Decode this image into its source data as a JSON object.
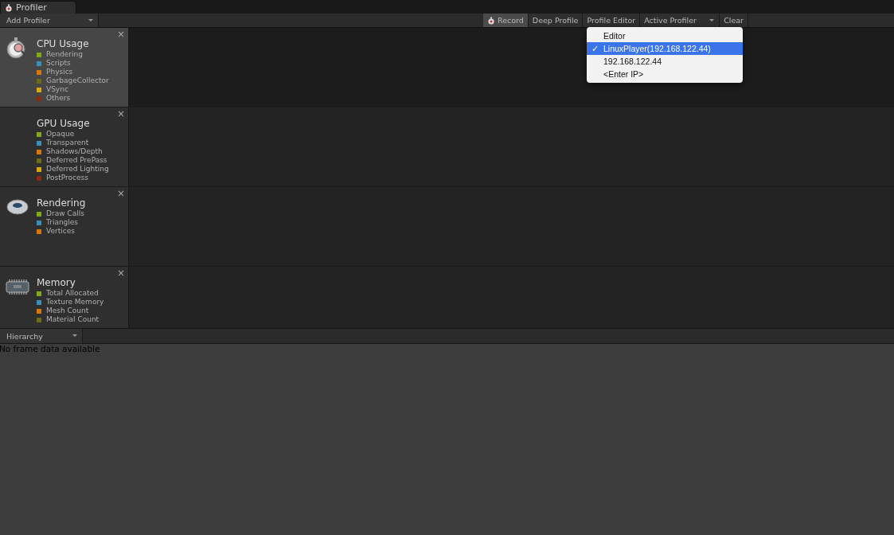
{
  "window_tab": {
    "title": "Profiler"
  },
  "toolbar": {
    "add_profiler": "Add Profiler",
    "buttons": [
      {
        "label": "Record",
        "kind": "record",
        "selected": true
      },
      {
        "label": "Deep Profile",
        "kind": "toggle",
        "selected": false
      },
      {
        "label": "Profile Editor",
        "kind": "toggle",
        "selected": false
      },
      {
        "label": "Active Profiler",
        "kind": "dropdown",
        "selected": false
      },
      {
        "label": "Clear",
        "kind": "toggle",
        "selected": false
      }
    ]
  },
  "profilers": [
    {
      "title": "CPU Usage",
      "kind": "stopwatch",
      "selected": true,
      "close": "×",
      "legend": [
        {
          "label": "Rendering",
          "color": "#7fa81a"
        },
        {
          "label": "Scripts",
          "color": "#3b8fb8"
        },
        {
          "label": "Physics",
          "color": "#d9760a"
        },
        {
          "label": "GarbageCollector",
          "color": "#6e6a16"
        },
        {
          "label": "VSync",
          "color": "#d6aa0c"
        },
        {
          "label": "Others",
          "color": "#8a2a0c"
        }
      ]
    },
    {
      "title": "GPU Usage",
      "kind": "plain",
      "selected": false,
      "close": "×",
      "legend": [
        {
          "label": "Opaque",
          "color": "#7fa81a"
        },
        {
          "label": "Transparent",
          "color": "#3b8fb8"
        },
        {
          "label": "Shadows/Depth",
          "color": "#d9760a"
        },
        {
          "label": "Deferred PrePass",
          "color": "#6e6a16"
        },
        {
          "label": "Deferred Lighting",
          "color": "#d6aa0c"
        },
        {
          "label": "PostProcess",
          "color": "#8a2a0c"
        }
      ]
    },
    {
      "title": "Rendering",
      "kind": "torus",
      "selected": false,
      "close": "×",
      "legend": [
        {
          "label": "Draw Calls",
          "color": "#7fa81a"
        },
        {
          "label": "Triangles",
          "color": "#3b8fb8"
        },
        {
          "label": "Vertices",
          "color": "#d9760a"
        }
      ]
    },
    {
      "title": "Memory",
      "kind": "chip",
      "selected": false,
      "close": "×",
      "legend": [
        {
          "label": "Total Allocated",
          "color": "#7fa81a"
        },
        {
          "label": "Texture Memory",
          "color": "#3b8fb8"
        },
        {
          "label": "Mesh Count",
          "color": "#d9760a"
        },
        {
          "label": "Material Count",
          "color": "#6e6a16"
        }
      ]
    }
  ],
  "details": {
    "view": "Hierarchy",
    "message": "No frame data available"
  },
  "dropdown": {
    "items": [
      {
        "label": "Editor",
        "selected": false
      },
      {
        "label": "LinuxPlayer(192.168.122.44)",
        "selected": true,
        "check": "✓"
      },
      {
        "label": "192.168.122.44",
        "selected": false
      },
      {
        "label": "<Enter IP>",
        "selected": false
      }
    ]
  }
}
